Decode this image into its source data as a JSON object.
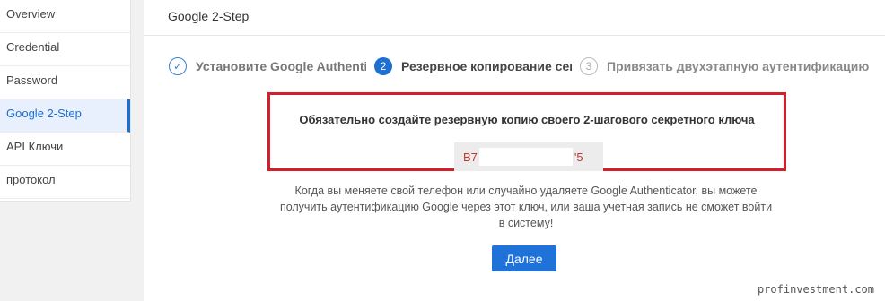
{
  "sidebar": {
    "items": [
      {
        "label": "Overview"
      },
      {
        "label": "Credential"
      },
      {
        "label": "Password"
      },
      {
        "label": "Google 2-Step"
      },
      {
        "label": "API Ключи"
      },
      {
        "label": "протокол"
      }
    ],
    "active_index": 3
  },
  "header": {
    "title": "Google 2-Step"
  },
  "steps": [
    {
      "number": "✓",
      "label": "Установите Google Authenticator",
      "state": "done"
    },
    {
      "number": "2",
      "label": "Резервное копирование секретного ключа",
      "state": "current"
    },
    {
      "number": "3",
      "label": "Привязать двухэтапную аутентификацию",
      "state": "pending"
    }
  ],
  "backup": {
    "warning": "Обязательно создайте резервную копию своего 2-шагового секретного ключа",
    "key_start": "B7",
    "key_end": "'5"
  },
  "description": "Когда вы меняете свой телефон или случайно удаляете Google Authenticator, вы можете получить аутентификацию Google через этот ключ, или ваша учетная запись не сможет войти в систему!",
  "next_button": "Далее",
  "watermark": "profinvestment.com",
  "colors": {
    "accent": "#1f72d8",
    "highlight_border": "#d11f2b",
    "key_text": "#c0392b"
  }
}
